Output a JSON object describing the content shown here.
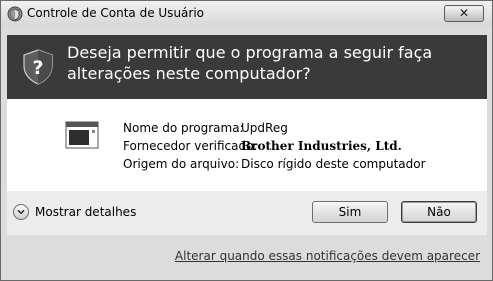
{
  "window": {
    "title": "Controle de Conta de Usuário",
    "close_label": "✕",
    "title_icon": "uac-shield-icon"
  },
  "banner": {
    "question": "Deseja permitir que o programa a seguir faça alterações neste computador?",
    "icon": "question-shield-icon"
  },
  "program": {
    "icon": "program-icon",
    "rows": [
      {
        "label": "Nome do programa:",
        "value": "UpdReg"
      },
      {
        "label": "Fornecedor verificado:",
        "value": "Brother Industries, Ltd."
      },
      {
        "label": "Origem do arquivo:",
        "value": "Disco rígido deste computador"
      }
    ]
  },
  "details": {
    "label": "Mostrar detalhes",
    "icon": "chevron-down-icon"
  },
  "buttons": {
    "yes": "Sim",
    "no": "Não"
  },
  "footer": {
    "link": "Alterar quando essas notificações devem aparecer"
  }
}
